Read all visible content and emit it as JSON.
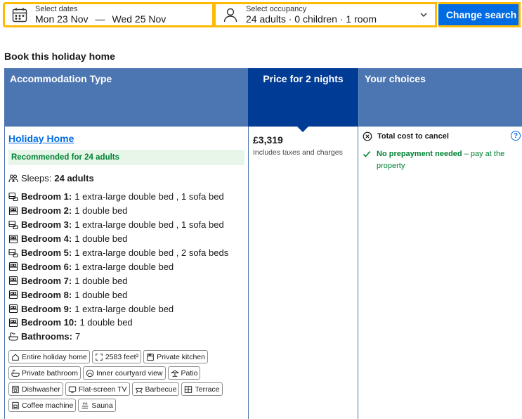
{
  "search": {
    "dates_label": "Select dates",
    "check_in": "Mon 23 Nov",
    "dash": "—",
    "check_out": "Wed 25 Nov",
    "occupancy_label": "Select occupancy",
    "occupancy_value": "24 adults · 0 children · 1 room",
    "button": "Change search"
  },
  "section_title": "Book this holiday home",
  "table": {
    "headers": {
      "accommodation": "Accommodation Type",
      "price": "Price for 2 nights",
      "choices": "Your choices"
    },
    "room": {
      "name": "Holiday Home",
      "recommended": "Recommended for 24 adults",
      "sleeps_label": "Sleeps:",
      "sleeps_value": "24 adults",
      "bedrooms": [
        {
          "label": "Bedroom 1:",
          "beds": "1 extra-large double bed , 1 sofa bed",
          "icon": "bed-sofa-icon"
        },
        {
          "label": "Bedroom 2:",
          "beds": "1 double bed",
          "icon": "bed-icon"
        },
        {
          "label": "Bedroom 3:",
          "beds": "1 extra-large double bed , 1 sofa bed",
          "icon": "bed-sofa-icon"
        },
        {
          "label": "Bedroom 4:",
          "beds": "1 double bed",
          "icon": "bed-icon"
        },
        {
          "label": "Bedroom 5:",
          "beds": "1 extra-large double bed , 2 sofa beds",
          "icon": "bed-sofa-icon"
        },
        {
          "label": "Bedroom 6:",
          "beds": "1 extra-large double bed",
          "icon": "bed-icon"
        },
        {
          "label": "Bedroom 7:",
          "beds": "1 double bed",
          "icon": "bed-icon"
        },
        {
          "label": "Bedroom 8:",
          "beds": "1 double bed",
          "icon": "bed-icon"
        },
        {
          "label": "Bedroom 9:",
          "beds": "1 extra-large double bed",
          "icon": "bed-icon"
        },
        {
          "label": "Bedroom 10:",
          "beds": "1 double bed",
          "icon": "bed-icon"
        }
      ],
      "bathrooms_label": "Bathrooms:",
      "bathrooms_value": "7",
      "facilities": [
        [
          "Entire holiday home",
          "2583 feet²",
          "Private kitchen"
        ],
        [
          "Private bathroom",
          "Inner courtyard view",
          "Patio"
        ],
        [
          "Dishwasher",
          "Flat-screen TV",
          "Barbecue",
          "Terrace"
        ],
        [
          "Coffee machine",
          "Sauna"
        ]
      ]
    },
    "price": {
      "amount": "£3,319",
      "note": "Includes taxes and charges"
    },
    "choices": {
      "cancel": "Total cost to cancel",
      "help": "?",
      "prepay_bold": "No prepayment needed",
      "prepay_rest": " – pay at the property"
    }
  },
  "colors": {
    "brand_blue": "#006ce4",
    "header_blue": "#4c76b2",
    "header_dark": "#003b95",
    "accent_yellow": "#febb02",
    "green": "#008234"
  }
}
